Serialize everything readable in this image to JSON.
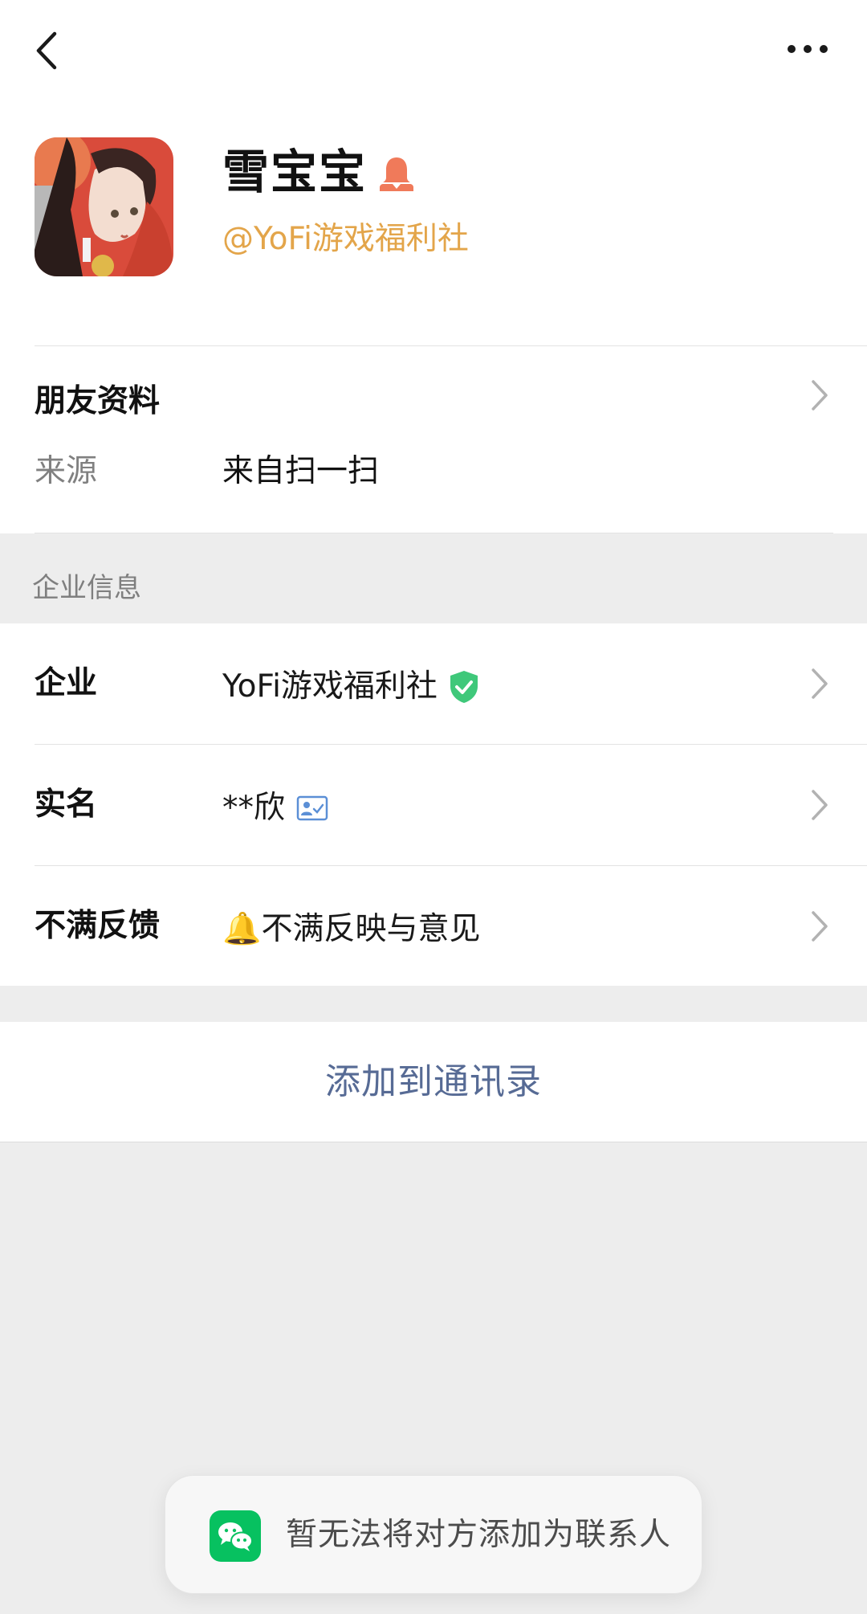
{
  "header": {
    "back_icon": "chevron-left-icon",
    "more_icon": "ellipsis-icon"
  },
  "profile": {
    "name": "雪宝宝",
    "org_handle": "@YoFi游戏福利社",
    "gender_icon": "person-icon",
    "accent_color": "#e3a54a"
  },
  "friend_info": {
    "title": "朋友资料",
    "source_label": "来源",
    "source_value": "来自扫一扫"
  },
  "company_section": {
    "title": "企业信息",
    "rows": [
      {
        "label": "企业",
        "value": "YoFi游戏福利社",
        "icon": "verified-shield-icon"
      },
      {
        "label": "实名",
        "value": "**欣",
        "icon": "id-card-icon"
      },
      {
        "label": "不满反馈",
        "value": "🔔不满反映与意见",
        "icon": ""
      }
    ]
  },
  "actions": {
    "add_contact": "添加到通讯录",
    "link_color": "#576b95"
  },
  "toast": {
    "message": "暂无法将对方添加为联系人",
    "icon": "wechat-icon"
  }
}
